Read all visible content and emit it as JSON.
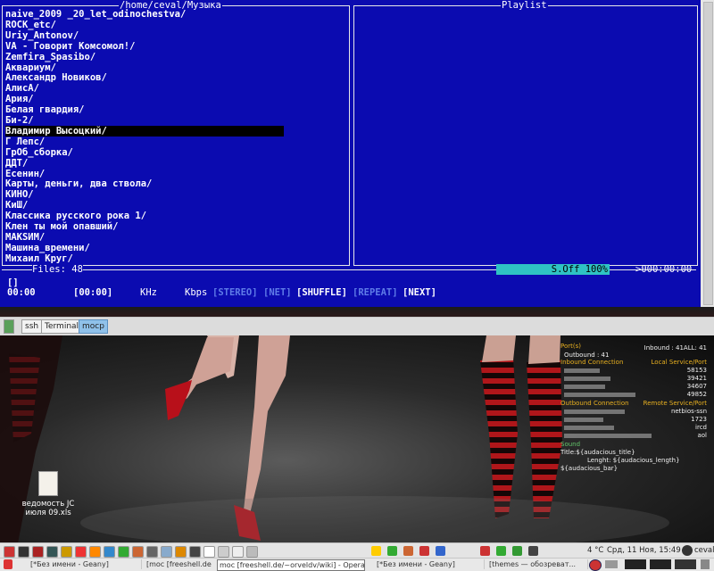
{
  "terminal": {
    "left_title": "/home/ceval/Музыка",
    "right_title": "Playlist",
    "files": [
      "naive_2009 _20_let_odinochestva/",
      "ROCK_etc/",
      "Uriy_Antonov/",
      "VA - Говорит Комсомол!/",
      "Zemfira_Spasibo/",
      "Аквариум/",
      "Александр Новиков/",
      "АлисА/",
      "Ария/",
      "Белая гвардия/",
      "Би-2/",
      "Владимир Высоцкий/",
      "Г Лепс/",
      "ГрОб_сборка/",
      "ДДТ/",
      "Есенин/",
      "Карты, деньги, два ствола/",
      "КИНО/",
      "КиШ/",
      "Классика русского рока 1/",
      "Клен ты мой опавший/",
      "MAKSИM/",
      "Машина_времени/",
      "Михаил Круг/"
    ],
    "selected_index": 11,
    "files_count": "Files: 48",
    "volume": "S.Off 100%",
    "time": ">000:00:00",
    "title_line": "[]",
    "status": {
      "elapsed": "00:00",
      "total": "[00:00]",
      "khz": "KHz",
      "kbps": "Kbps",
      "stereo": "[STEREO]",
      "net": "[NET]",
      "shuffle": "[SHUFFLE]",
      "repeat": "[REPEAT]",
      "next": "[NEXT]"
    }
  },
  "taskbar_tabs": [
    "ssh",
    "Terminal",
    "mocp"
  ],
  "conky": {
    "ports_label": "Port(s)",
    "inbound_all": "Inbound : 41ALL: 41",
    "outbound": "Outbound : 41",
    "inbound_connection": "Inbound Connection",
    "local_service": "Local Service/Port",
    "local_ports": [
      "58153",
      "39421",
      "34607",
      "49852"
    ],
    "outbound_connection": "Outbound Connection",
    "remote_service": "Remote Service/Port",
    "remote_ports": [
      "netbios-ssn",
      "1723",
      "ircd",
      "aol"
    ],
    "sound_label": "Sound",
    "title_line": "Title:${audacious_title}",
    "length_line": "Lenght: ${audacious_length}",
    "bar_line": "${audacious_bar}"
  },
  "desktop_icon": {
    "label_line1": "ведомость JC",
    "label_line2": "июля 09.xls"
  },
  "panel": {
    "weather": "4 °C",
    "clock": "Срд, 11 Ноя, 15:49",
    "user": "ceval",
    "tasks": [
      "[*Без имени - Geany]",
      "[moc [freeshell.de",
      "moc [freeshell.de/~orveldv/wiki] - Opera",
      "[*Без имени - Geany]",
      "[themes — обозреват..."
    ],
    "accent": "#0b0bb0",
    "highlight": "#2fc3c3"
  }
}
